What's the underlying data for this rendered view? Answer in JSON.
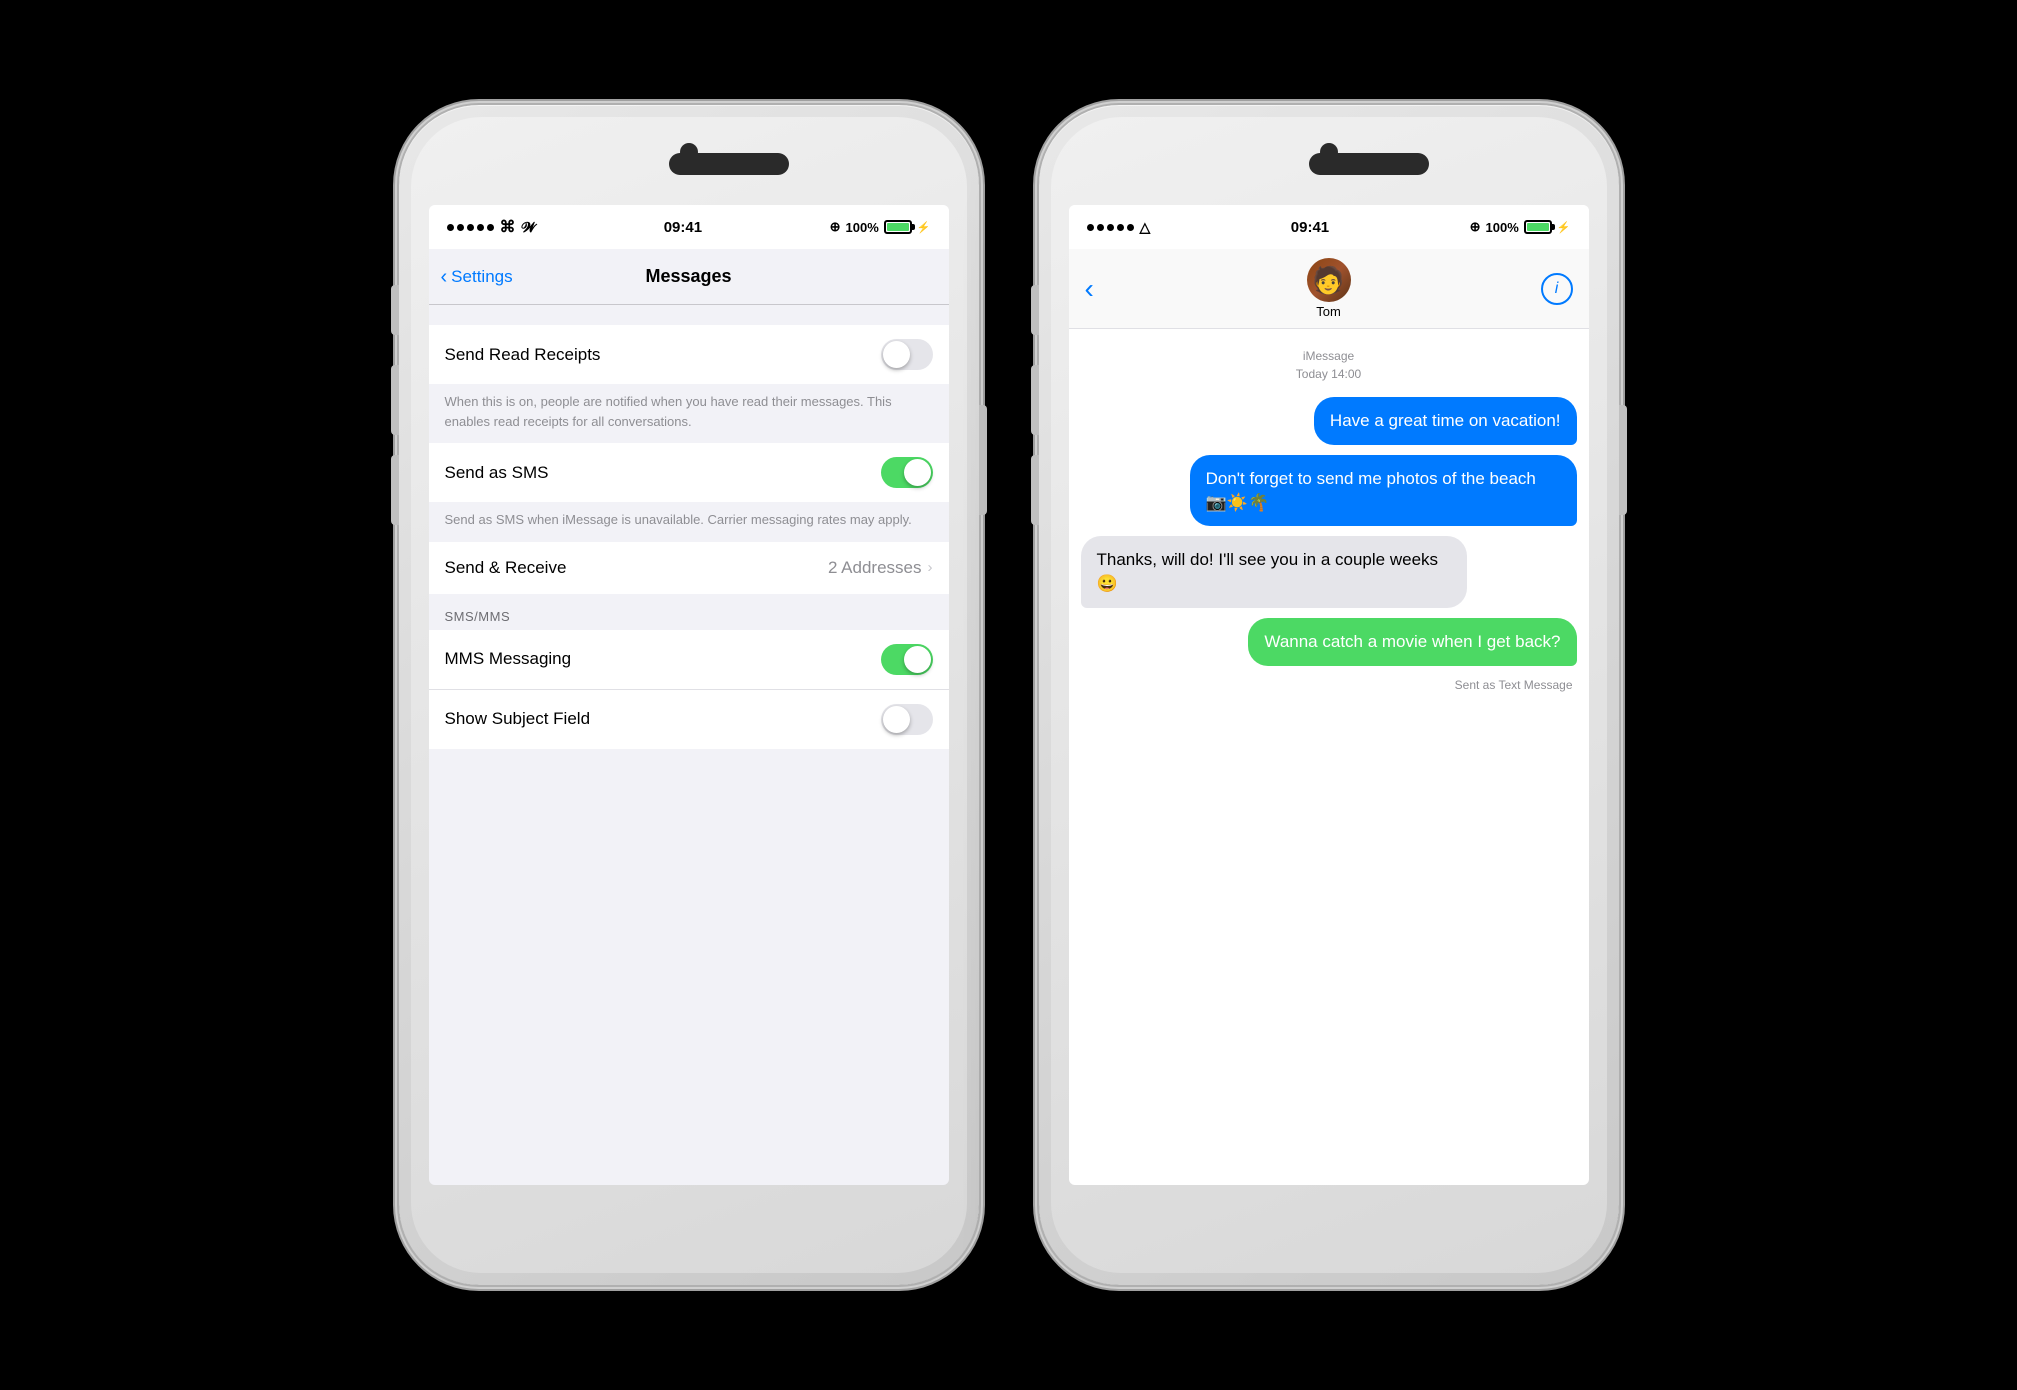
{
  "phone1": {
    "statusBar": {
      "time": "09:41",
      "battery": "100%",
      "signal": "•••••",
      "wifi": "wifi"
    },
    "nav": {
      "back": "Settings",
      "title": "Messages"
    },
    "sections": [
      {
        "id": "read-receipts",
        "rows": [
          {
            "label": "Send Read Receipts",
            "toggleState": "off"
          }
        ],
        "description": "When this is on, people are notified when you have read their messages. This enables read receipts for all conversations."
      },
      {
        "id": "send-as-sms",
        "rows": [
          {
            "label": "Send as SMS",
            "toggleState": "on"
          }
        ],
        "description": "Send as SMS when iMessage is unavailable. Carrier messaging rates may apply."
      },
      {
        "id": "send-receive",
        "rows": [
          {
            "label": "Send & Receive",
            "value": "2 Addresses"
          }
        ]
      },
      {
        "id": "sms-mms",
        "sectionLabel": "SMS/MMS",
        "rows": [
          {
            "label": "MMS Messaging",
            "toggleState": "on"
          },
          {
            "label": "Show Subject Field",
            "toggleState": "off"
          }
        ]
      }
    ]
  },
  "phone2": {
    "statusBar": {
      "time": "09:41",
      "battery": "100%"
    },
    "contact": {
      "name": "Tom",
      "avatarEmoji": "🧑"
    },
    "messages": [
      {
        "id": "timestamp1",
        "type": "timestamp",
        "text": "iMessage",
        "subtext": "Today 14:00"
      },
      {
        "id": "msg1",
        "type": "sent",
        "style": "blue",
        "text": "Have a great time on vacation!"
      },
      {
        "id": "msg2",
        "type": "sent",
        "style": "blue",
        "text": "Don't forget to send me photos of the beach 📷☀️🌴"
      },
      {
        "id": "msg3",
        "type": "received",
        "style": "gray",
        "text": "Thanks, will do! I'll see you in a couple weeks 😀"
      },
      {
        "id": "msg4",
        "type": "sent",
        "style": "green",
        "text": "Wanna catch a movie when I get back?"
      },
      {
        "id": "msg4-status",
        "type": "status",
        "text": "Sent as Text Message"
      }
    ]
  }
}
